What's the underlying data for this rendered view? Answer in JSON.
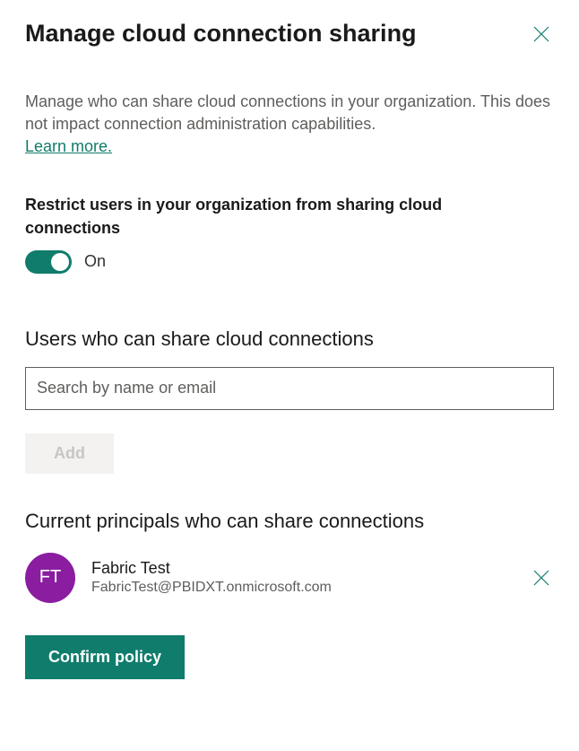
{
  "header": {
    "title": "Manage cloud connection sharing"
  },
  "description": "Manage who can share cloud connections in your organization. This does not impact connection administration capabilities.",
  "learn_more_label": "Learn more.",
  "restrict": {
    "label": "Restrict users in your organization from sharing cloud connections",
    "state_label": "On"
  },
  "users_section": {
    "heading": "Users who can share cloud connections",
    "search_placeholder": "Search by name or email",
    "add_label": "Add"
  },
  "principals_section": {
    "heading": "Current principals who can share connections",
    "items": [
      {
        "initials": "FT",
        "name": "Fabric Test",
        "email": "FabricTest@PBIDXT.onmicrosoft.com"
      }
    ]
  },
  "confirm_label": "Confirm policy",
  "colors": {
    "accent": "#107c6c",
    "avatar": "#8a1da0"
  }
}
